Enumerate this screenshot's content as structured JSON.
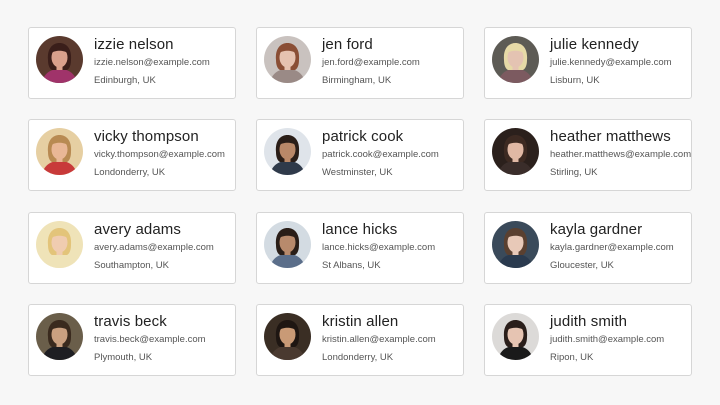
{
  "users": [
    {
      "name": "izzie nelson",
      "email": "izzie.nelson@example.com",
      "location": "Edinburgh, UK",
      "avatar_colors": {
        "bg": "#5a3a2e",
        "skin": "#d9a08c",
        "hair": "#3a1e1a",
        "shirt": "#a0336a"
      }
    },
    {
      "name": "jen ford",
      "email": "jen.ford@example.com",
      "location": "Birmingham, UK",
      "avatar_colors": {
        "bg": "#c9c2bf",
        "skin": "#e6c2b0",
        "hair": "#8a4e35",
        "shirt": "#9a8a86"
      }
    },
    {
      "name": "julie kennedy",
      "email": "julie.kennedy@example.com",
      "location": "Lisburn, UK",
      "avatar_colors": {
        "bg": "#5d5b55",
        "skin": "#e4c3b2",
        "hair": "#e6d9a6",
        "shirt": "#7c5a60"
      }
    },
    {
      "name": "vicky thompson",
      "email": "vicky.thompson@example.com",
      "location": "Londonderry, UK",
      "avatar_colors": {
        "bg": "#e6cfa2",
        "skin": "#e9b796",
        "hair": "#b88a52",
        "shirt": "#c83a3a"
      }
    },
    {
      "name": "patrick cook",
      "email": "patrick.cook@example.com",
      "location": "Westminster, UK",
      "avatar_colors": {
        "bg": "#dfe4ea",
        "skin": "#b98868",
        "hair": "#2a1e18",
        "shirt": "#2f3a4a"
      }
    },
    {
      "name": "heather matthews",
      "email": "heather.matthews@example.com",
      "location": "Stirling, UK",
      "avatar_colors": {
        "bg": "#2b201c",
        "skin": "#e0b8a4",
        "hair": "#3d2a22",
        "shirt": "#3a2d2a"
      }
    },
    {
      "name": "avery adams",
      "email": "avery.adams@example.com",
      "location": "Southampton, UK",
      "avatar_colors": {
        "bg": "#efe3b8",
        "skin": "#f0ccb0",
        "hair": "#e3c47a",
        "shirt": "#efe3b8"
      }
    },
    {
      "name": "lance hicks",
      "email": "lance.hicks@example.com",
      "location": "St Albans, UK",
      "avatar_colors": {
        "bg": "#d3dbe2",
        "skin": "#b88a6c",
        "hair": "#2a1e18",
        "shirt": "#5b6e8a"
      }
    },
    {
      "name": "kayla gardner",
      "email": "kayla.gardner@example.com",
      "location": "Gloucester, UK",
      "avatar_colors": {
        "bg": "#3a4a5a",
        "skin": "#e8c9b8",
        "hair": "#5a4030",
        "shirt": "#2a3a4e"
      }
    },
    {
      "name": "travis beck",
      "email": "travis.beck@example.com",
      "location": "Plymouth, UK",
      "avatar_colors": {
        "bg": "#6a5e4a",
        "skin": "#caa080",
        "hair": "#3a2a1e",
        "shirt": "#1e1e22"
      }
    },
    {
      "name": "kristin allen",
      "email": "kristin.allen@example.com",
      "location": "Londonderry, UK",
      "avatar_colors": {
        "bg": "#3a2e24",
        "skin": "#c99a76",
        "hair": "#1e1612",
        "shirt": "#4a3a30"
      }
    },
    {
      "name": "judith smith",
      "email": "judith.smith@example.com",
      "location": "Ripon, UK",
      "avatar_colors": {
        "bg": "#dcdad8",
        "skin": "#e6c4b2",
        "hair": "#2a1e1a",
        "shirt": "#1a1a1a"
      }
    }
  ]
}
